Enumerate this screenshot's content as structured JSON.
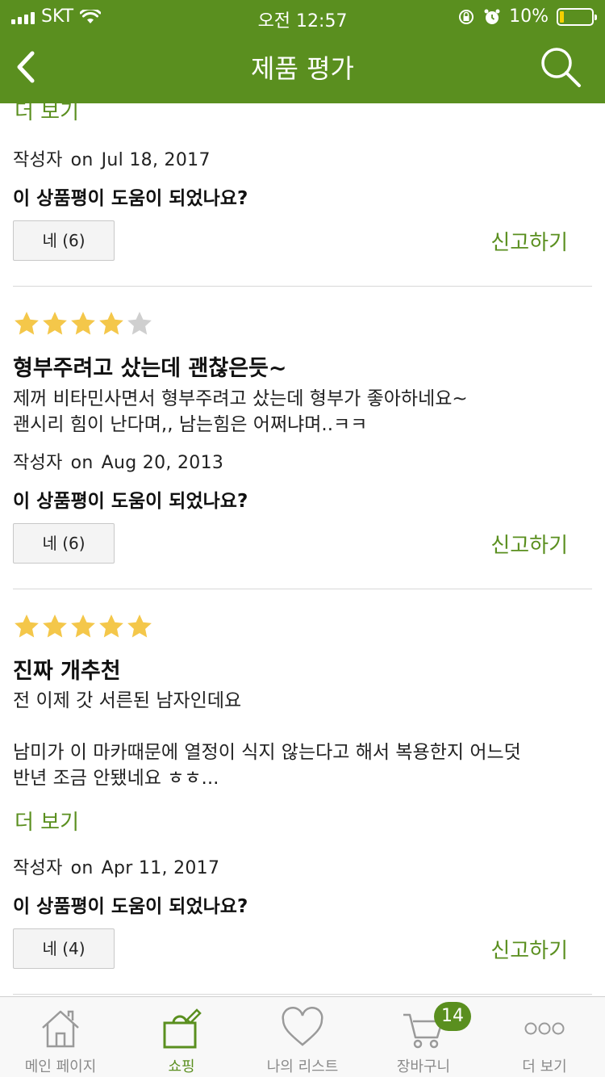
{
  "status_bar": {
    "carrier": "SKT",
    "time": "오전 12:57",
    "battery": "10%"
  },
  "header": {
    "title": "제품 평가"
  },
  "colors": {
    "brand": "#5a8f1f",
    "star": "#f4c74a",
    "star_empty": "#cfcfcf"
  },
  "top_fragment": {
    "more_label": "더 보기",
    "author": "작성자",
    "on": "on",
    "date": "Jul 18, 2017",
    "helpful_question": "이 상품평이 도움이 되었나요?",
    "yes_label": "네 (6)",
    "report_label": "신고하기"
  },
  "reviews": [
    {
      "rating": 4,
      "title": "형부주려고 샀는데 괜찮은듯~",
      "body_lines": [
        "제꺼 비타민사면서 형부주려고 샀는데 형부가 좋아하네요~",
        "괜시리 힘이 난다며,, 남는힘은 어쩌냐며..ㅋㅋ"
      ],
      "author": "작성자",
      "on": "on",
      "date": "Aug 20, 2013",
      "helpful_question": "이 상품평이 도움이 되었나요?",
      "yes_label": "네 (6)",
      "report_label": "신고하기"
    },
    {
      "rating": 5,
      "title": "진짜 개추천",
      "body_lines": [
        "전 이제 갓 서른된 남자인데요",
        "",
        "남미가 이 마카때문에 열정이 식지 않는다고 해서 복용한지 어느덧",
        "반년 조금 안됐네요  ㅎㅎ..."
      ],
      "more_label": "더 보기",
      "author": "작성자",
      "on": "on",
      "date": "Apr 11, 2017",
      "helpful_question": "이 상품평이 도움이 되었나요?",
      "yes_label": "네 (4)",
      "report_label": "신고하기"
    }
  ],
  "tabbar": {
    "items": [
      {
        "label": "메인 페이지",
        "icon": "home-icon"
      },
      {
        "label": "쇼핑",
        "icon": "shopping-bag-icon"
      },
      {
        "label": "나의 리스트",
        "icon": "heart-icon"
      },
      {
        "label": "장바구니",
        "icon": "cart-icon",
        "badge": "14"
      },
      {
        "label": "더 보기",
        "icon": "more-dots-icon"
      }
    ],
    "active_index": 1
  }
}
